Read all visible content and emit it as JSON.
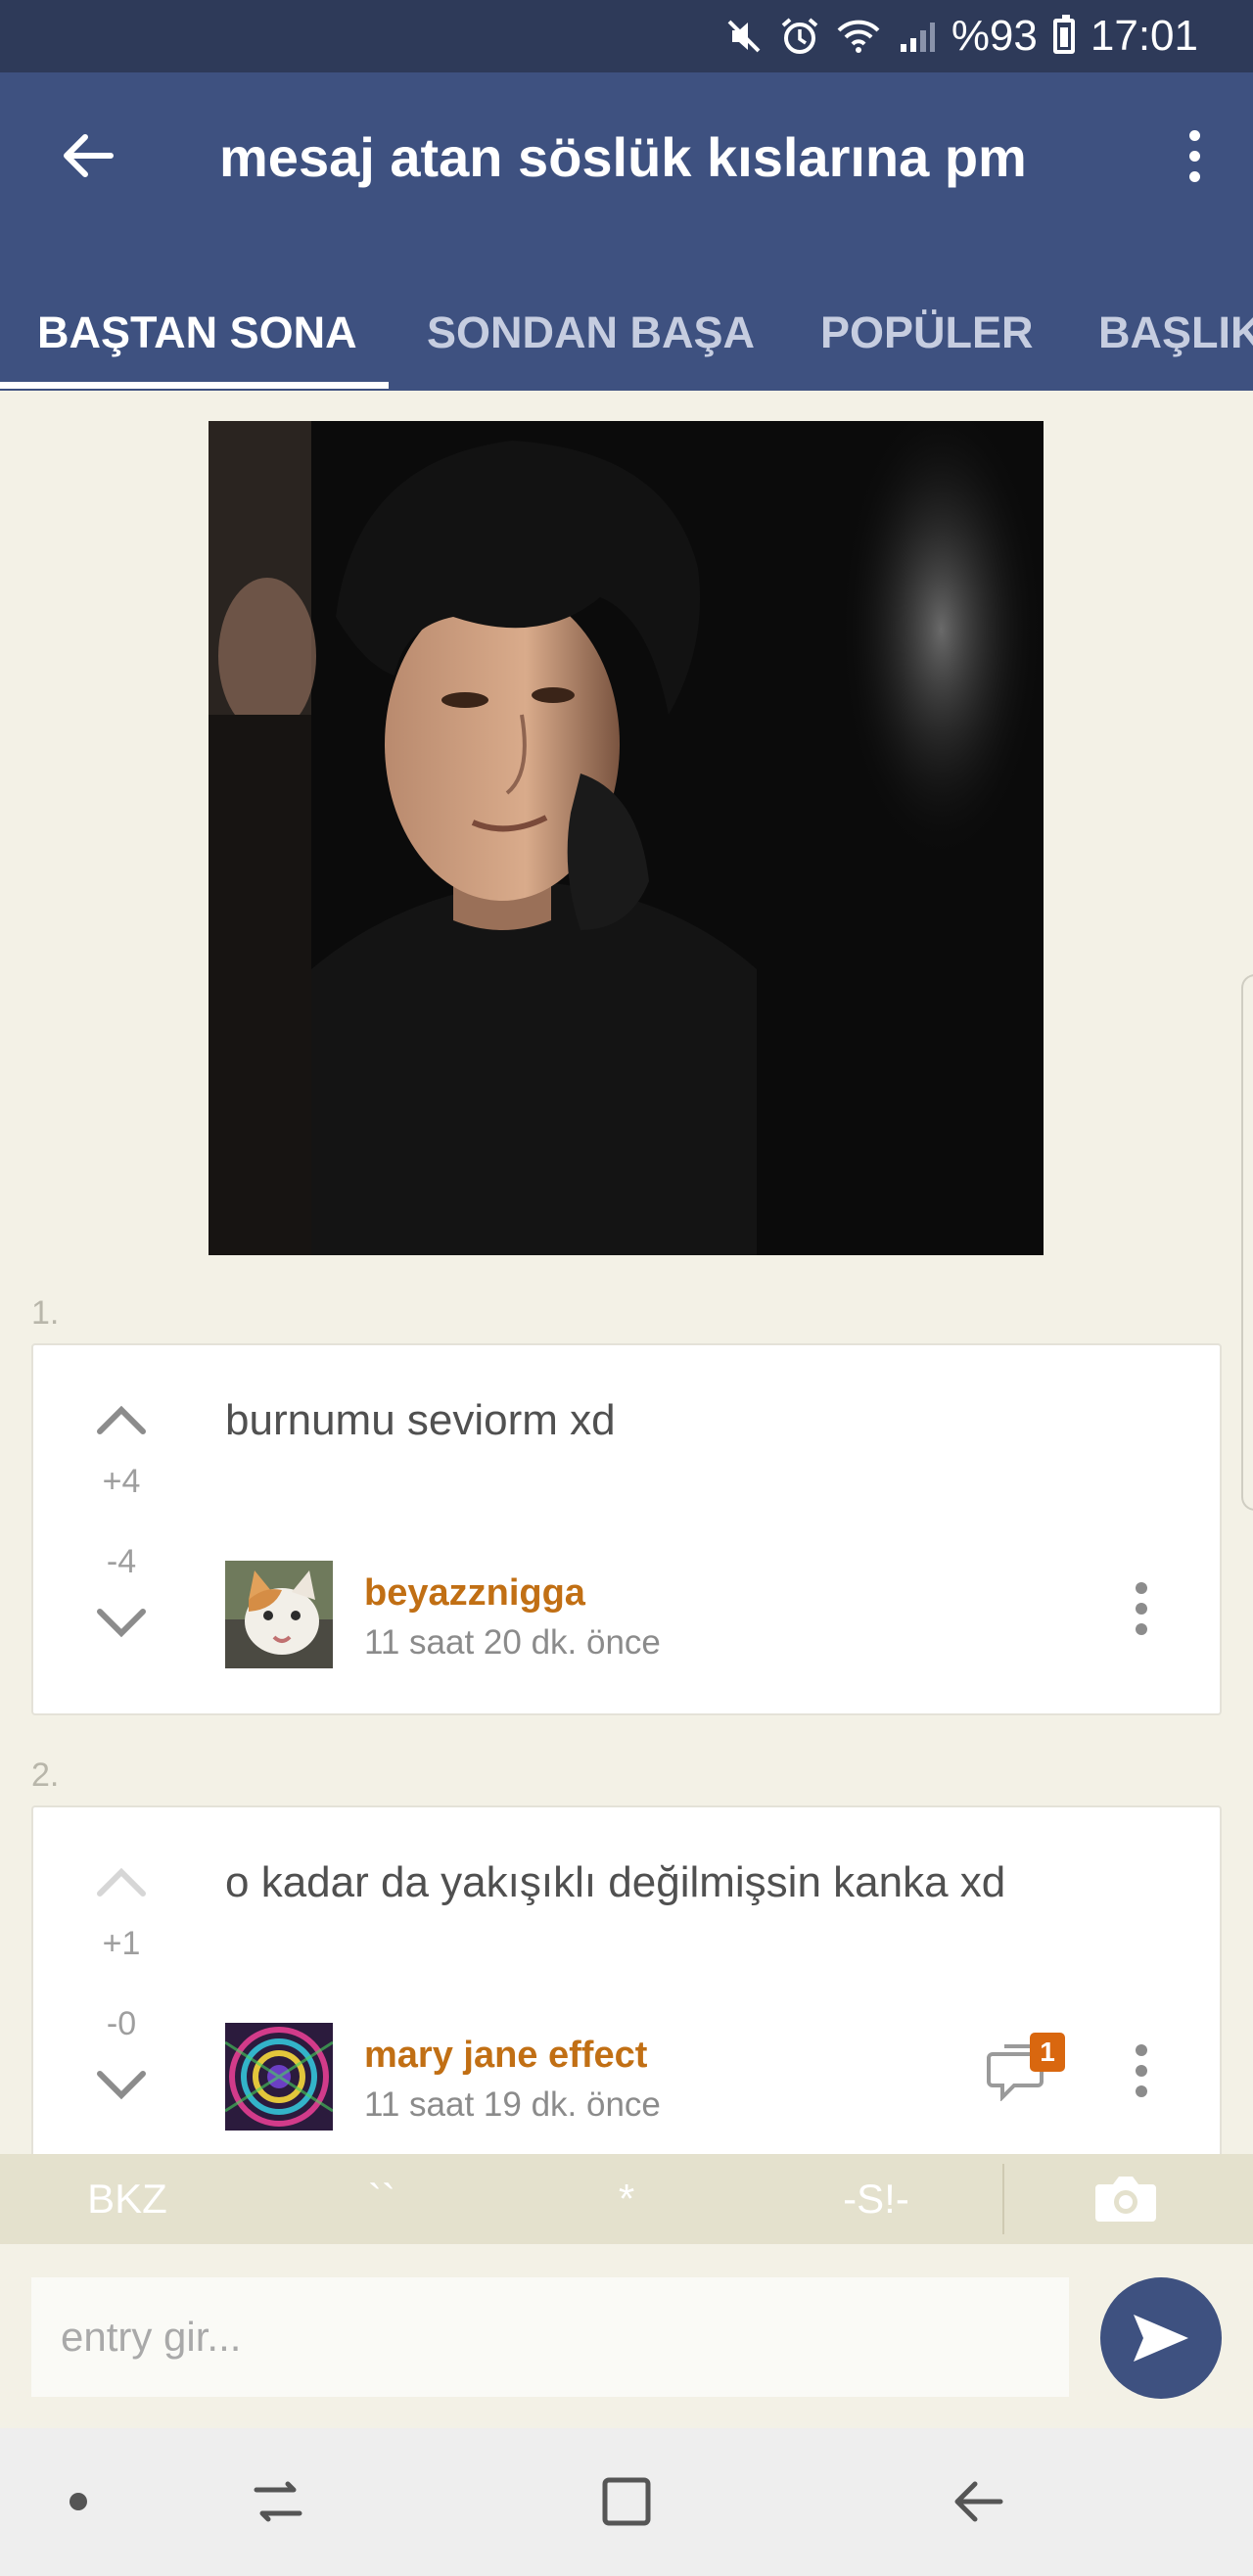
{
  "status_bar": {
    "battery": "%93",
    "time": "17:01"
  },
  "app_bar": {
    "title": "mesaj atan söslük kıslarına pm",
    "tabs": [
      {
        "label": "BAŞTAN SONA",
        "active": true
      },
      {
        "label": "SONDAN BAŞA",
        "active": false
      },
      {
        "label": "POPÜLER",
        "active": false
      },
      {
        "label": "BAŞLIK",
        "active": false
      }
    ]
  },
  "entries": [
    {
      "number": "1.",
      "text": "burnumu seviorm xd",
      "upvotes": "+4",
      "downvotes": "-4",
      "author": "beyazznigga",
      "timestamp": "11 saat 20 dk. önce"
    },
    {
      "number": "2.",
      "text": "o kadar da yakışıklı değilmişsin kanka xd",
      "upvotes": "+1",
      "downvotes": "-0",
      "author": "mary jane effect",
      "timestamp": "11 saat 19 dk. önce",
      "comment_count": "1"
    }
  ],
  "format_bar": {
    "bkz": "BKZ",
    "backticks": "``",
    "asterisk": "*",
    "spoiler": "-S!-"
  },
  "input": {
    "placeholder": "entry gir..."
  },
  "colors": {
    "status_bar": "#2e3a59",
    "app_bar": "#3e5180",
    "author": "#c16f14",
    "badge": "#d9670f",
    "background": "#f3f1e6"
  }
}
